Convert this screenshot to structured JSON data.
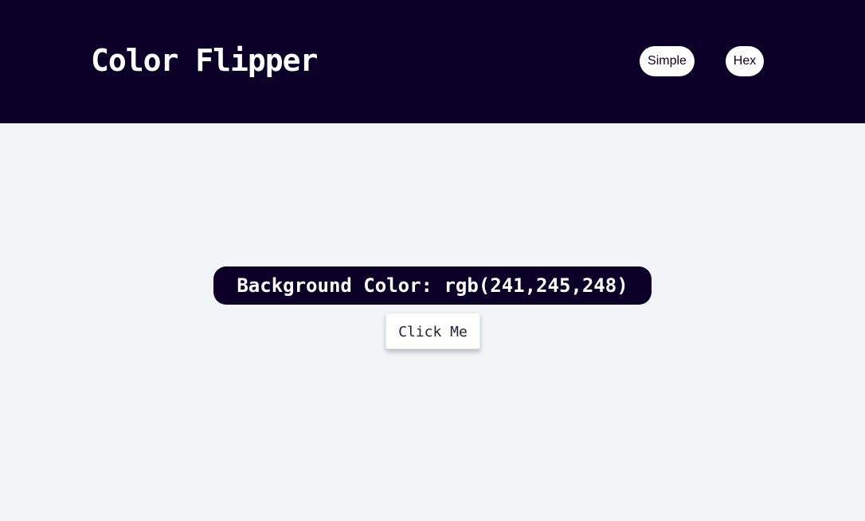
{
  "nav": {
    "logo": "Color Flipper",
    "links": [
      {
        "label": "Simple"
      },
      {
        "label": "Hex"
      }
    ]
  },
  "main": {
    "label_prefix": "Background Color: ",
    "color_value": "rgb(241,245,248)",
    "button_label": "Click Me"
  },
  "colors": {
    "nav_bg": "#0c0028",
    "page_bg": "#f1f5f8",
    "pill_bg": "#ffffff"
  }
}
